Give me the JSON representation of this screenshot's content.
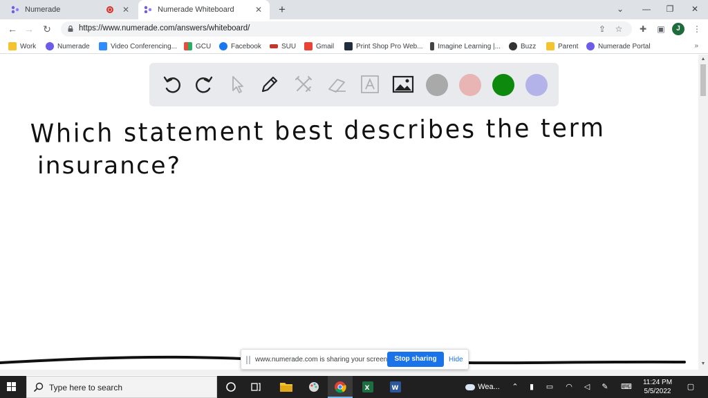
{
  "browser": {
    "tabs": [
      {
        "title": "Numerade",
        "active": false,
        "recording": true
      },
      {
        "title": "Numerade Whiteboard",
        "active": true,
        "recording": false
      }
    ],
    "address": {
      "url": "https://www.numerade.com/answers/whiteboard/"
    },
    "profile_initial": "J",
    "bookmarks": [
      {
        "label": "Work",
        "icon": "folder-icon",
        "color": "#f4c430"
      },
      {
        "label": "Numerade",
        "icon": "numerade-icon",
        "color": "#6c5ce7"
      },
      {
        "label": "Video Conferencing...",
        "icon": "video-icon",
        "color": "#2d8cff"
      },
      {
        "label": "GCU",
        "icon": "grid-icon",
        "color": "#e74c3c"
      },
      {
        "label": "Facebook",
        "icon": "facebook-icon",
        "color": "#1877f2"
      },
      {
        "label": "SUU",
        "icon": "suu-icon",
        "color": "#c0392b"
      },
      {
        "label": "Gmail",
        "icon": "gmail-icon",
        "color": "#ea4335"
      },
      {
        "label": "Print Shop Pro Web...",
        "icon": "print-icon",
        "color": "#1f2d3d"
      },
      {
        "label": "Imagine Learning |...",
        "icon": "imagine-icon",
        "color": "#444444"
      },
      {
        "label": "Buzz",
        "icon": "buzz-icon",
        "color": "#333333"
      },
      {
        "label": "Parent",
        "icon": "folder-icon",
        "color": "#f4c430"
      },
      {
        "label": "Numerade Portal",
        "icon": "numerade-icon",
        "color": "#6c5ce7"
      }
    ]
  },
  "whiteboard": {
    "tools": [
      "undo-icon",
      "redo-icon",
      "pointer-icon",
      "pen-icon",
      "tools-icon",
      "eraser-icon",
      "text-icon",
      "image-icon"
    ],
    "colors": [
      "#a9a9a9",
      "#e8b4b4",
      "#0d8a0d",
      "#b3b3ea"
    ],
    "handwriting": [
      "Which statement best describes the term",
      "insurance?"
    ]
  },
  "share_banner": {
    "message": "www.numerade.com is sharing your screen.",
    "stop_label": "Stop sharing",
    "hide_label": "Hide"
  },
  "taskbar": {
    "search_placeholder": "Type here to search",
    "weather_label": "Wea...",
    "time": "11:24 PM",
    "date": "5/5/2022"
  }
}
